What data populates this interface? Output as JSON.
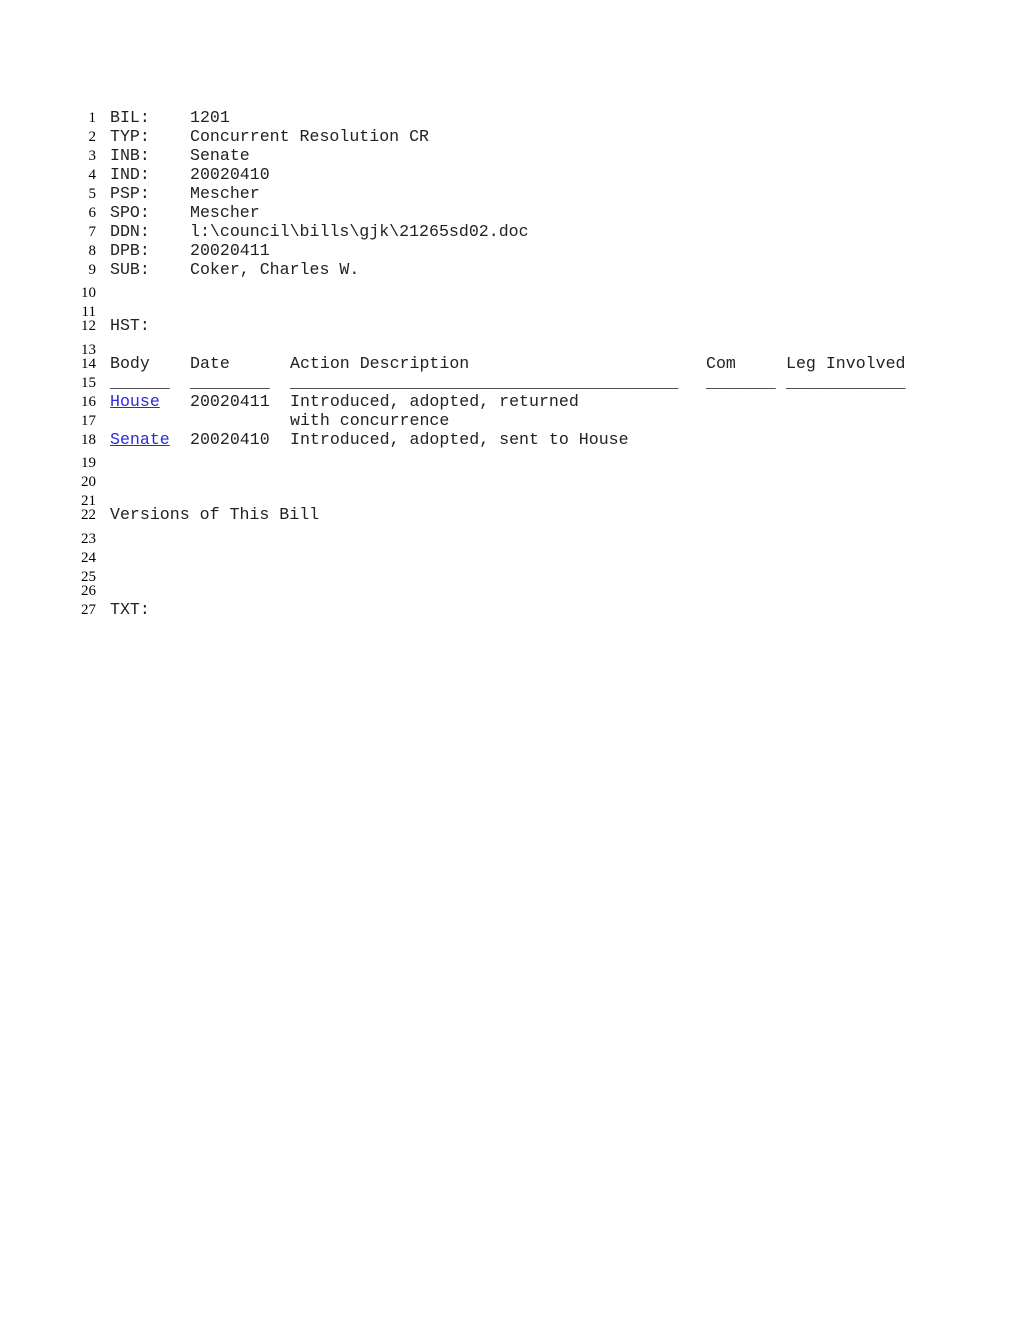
{
  "line_numbers": [
    "1",
    "2",
    "3",
    "4",
    "5",
    "6",
    "7",
    "8",
    "9",
    "10",
    "11",
    "12",
    "13",
    "14",
    "15",
    "16",
    "17",
    "18",
    "19",
    "20",
    "21",
    "22",
    "23",
    "24",
    "25",
    "26",
    "27"
  ],
  "fields": [
    {
      "label": "BIL:",
      "value": "1201"
    },
    {
      "label": "TYP:",
      "value": "Concurrent Resolution CR"
    },
    {
      "label": "INB:",
      "value": "Senate"
    },
    {
      "label": "IND:",
      "value": "20020410"
    },
    {
      "label": "PSP:",
      "value": "Mescher"
    },
    {
      "label": "SPO:",
      "value": "Mescher"
    },
    {
      "label": "DDN:",
      "value": "l:\\council\\bills\\gjk\\21265sd02.doc"
    },
    {
      "label": "DPB:",
      "value": "20020411"
    },
    {
      "label": "SUB:",
      "value": "Coker, Charles W."
    }
  ],
  "history": {
    "label": "HST:",
    "columns": {
      "body": "Body",
      "date": "Date",
      "action": "Action Description",
      "com": "Com",
      "leg": "Leg Involved"
    },
    "underlines": {
      "body": "______",
      "date": "________",
      "action": "_______________________________________",
      "com": "_______",
      "leg": "____________"
    },
    "rows": [
      {
        "body": "House",
        "date": "20020411",
        "action": "Introduced, adopted, returned",
        "action_cont": "with concurrence"
      },
      {
        "body": "Senate",
        "date": "20020410",
        "action": "Introduced, adopted, sent to House"
      }
    ]
  },
  "versions_heading": "Versions of This Bill",
  "text_label": "TXT:",
  "colors": {
    "link": "#2a2ae0",
    "text": "#222222"
  }
}
